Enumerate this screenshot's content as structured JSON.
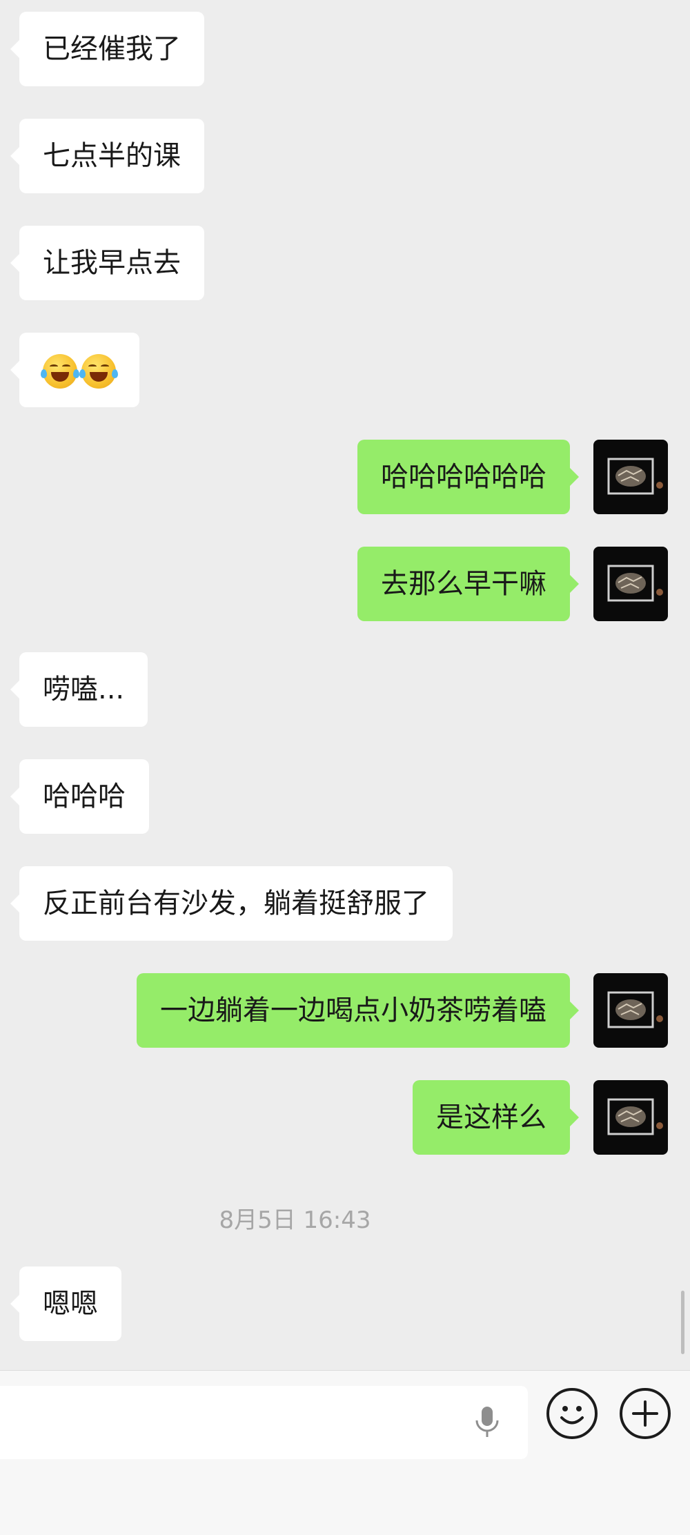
{
  "messages": [
    {
      "text": "已经催我了"
    },
    {
      "text": "七点半的课"
    },
    {
      "text": "让我早点去"
    },
    {
      "emoji": [
        "laugh-cry-emoji",
        "laugh-cry-emoji"
      ]
    },
    {
      "text": "哈哈哈哈哈哈"
    },
    {
      "text": "去那么早干嘛"
    },
    {
      "text": "唠嗑..."
    },
    {
      "text": "哈哈哈"
    },
    {
      "text": "反正前台有沙发，躺着挺舒服了"
    },
    {
      "text": "一边躺着一边喝点小奶茶唠着嗑"
    },
    {
      "text": "是这样么"
    },
    {
      "text": "嗯嗯"
    }
  ],
  "timestamp": "8月5日 16:43",
  "input": {
    "value": "",
    "placeholder": ""
  },
  "icons": {
    "voice": "microphone-icon",
    "emoji": "smiley-face-icon",
    "more": "plus-icon"
  },
  "colors": {
    "background": "#ededed",
    "incoming_bubble": "#ffffff",
    "outgoing_bubble": "#95ec69",
    "timestamp_text": "#a6a6a6"
  }
}
